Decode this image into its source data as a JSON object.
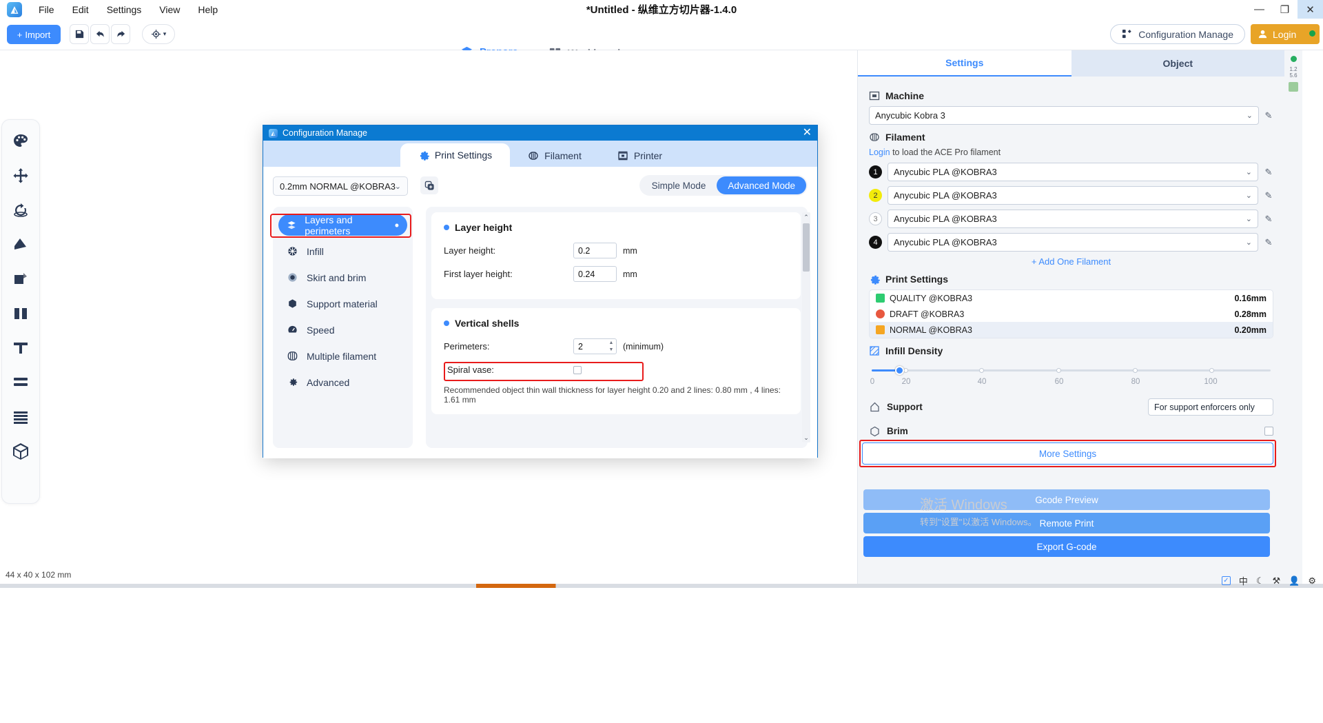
{
  "titlebar": {
    "title": "*Untitled - 纵维立方切片器-1.4.0",
    "menus": [
      "File",
      "Edit",
      "Settings",
      "View",
      "Help"
    ],
    "minimize": "—",
    "restore": "❐",
    "close": "✕"
  },
  "toolbar": {
    "import_label": "Import",
    "import_plus": "+",
    "save_icon": "save-icon",
    "undo_icon": "undo-icon",
    "redo_icon": "redo-icon",
    "view_icon": "view-target-icon",
    "view_caret": "▾",
    "tabs": [
      {
        "label": "Prepare",
        "active": true
      },
      {
        "label": "Workbench",
        "active": false
      }
    ],
    "config_manage_label": "Configuration Manage",
    "login_label": "Login"
  },
  "viewport": {
    "status_dims": "44 x 40 x 102 mm",
    "left_tools": [
      "palette-icon",
      "move-icon",
      "rotate-icon",
      "scale-icon",
      "cut-icon",
      "mirror-icon",
      "support-icon",
      "arrange-icon",
      "layer-icon",
      "cube-icon"
    ]
  },
  "right_panel": {
    "tabs": [
      {
        "label": "Settings",
        "active": true
      },
      {
        "label": "Object",
        "active": false
      }
    ],
    "machine": {
      "section_label": "Machine",
      "value": "Anycubic Kobra 3"
    },
    "filament": {
      "section_label": "Filament",
      "login_prefix": "Login",
      "login_text": " to load the ACE Pro filament",
      "slots": [
        {
          "num": "1",
          "value": "Anycubic PLA @KOBRA3",
          "color": "#111111",
          "text_color": "#ffffff"
        },
        {
          "num": "2",
          "value": "Anycubic PLA @KOBRA3",
          "color": "#f2eb0a",
          "text_color": "#333333"
        },
        {
          "num": "3",
          "value": "Anycubic PLA @KOBRA3",
          "color": "#ffffff",
          "text_color": "#777777"
        },
        {
          "num": "4",
          "value": "Anycubic PLA @KOBRA3",
          "color": "#111111",
          "text_color": "#ffffff"
        }
      ],
      "add_label": "+  Add One Filament"
    },
    "print_settings": {
      "section_label": "Print Settings",
      "rows": [
        {
          "name": "QUALITY @KOBRA3",
          "value": "0.16mm",
          "color": "#2ecc71",
          "selected": false
        },
        {
          "name": "DRAFT @KOBRA3",
          "value": "0.28mm",
          "color": "#e8583f",
          "selected": false
        },
        {
          "name": "NORMAL @KOBRA3",
          "value": "0.20mm",
          "color": "#f5a623",
          "selected": true
        }
      ]
    },
    "infill": {
      "section_label": "Infill Density",
      "labels": [
        "0",
        "20",
        "40",
        "60",
        "80",
        "100"
      ],
      "value": 10
    },
    "support": {
      "label": "Support",
      "value": "For support enforcers only"
    },
    "brim": {
      "label": "Brim",
      "checked": false
    },
    "more_settings_label": "More Settings",
    "buttons": {
      "gcode_preview": "Gcode Preview",
      "remote_print": "Remote Print",
      "export_gcode": "Export G-code"
    },
    "watermark": {
      "line1": "激活 Windows",
      "line2": "转到\"设置\"以激活 Windows。"
    },
    "scale_strip": {
      "top": "1.2",
      "bottom": "5.6"
    }
  },
  "dialog": {
    "title": "Configuration Manage",
    "close": "✕",
    "tabs": [
      {
        "label": "Print Settings",
        "icon": "gear-icon",
        "active": true
      },
      {
        "label": "Filament",
        "icon": "filament-icon",
        "active": false
      },
      {
        "label": "Printer",
        "icon": "printer-icon",
        "active": false
      }
    ],
    "preset": {
      "value": "0.2mm NORMAL @KOBRA3",
      "chevron": "⌄"
    },
    "copy_icon": "duplicate-icon",
    "modes": [
      {
        "label": "Simple Mode",
        "active": false
      },
      {
        "label": "Advanced Mode",
        "active": true
      }
    ],
    "nav": [
      {
        "label": "Layers and perimeters",
        "icon": "layers-icon",
        "active": true,
        "modified": true
      },
      {
        "label": "Infill",
        "icon": "infill-icon",
        "active": false
      },
      {
        "label": "Skirt and brim",
        "icon": "skirt-icon",
        "active": false
      },
      {
        "label": "Support material",
        "icon": "support-icon",
        "active": false
      },
      {
        "label": "Speed",
        "icon": "speed-icon",
        "active": false
      },
      {
        "label": "Multiple filament",
        "icon": "multi-filament-icon",
        "active": false
      },
      {
        "label": "Advanced",
        "icon": "advanced-icon",
        "active": false
      }
    ],
    "layer_height_card": {
      "title": "Layer height",
      "fields": [
        {
          "label": "Layer height:",
          "value": "0.2",
          "unit": "mm"
        },
        {
          "label": "First layer height:",
          "value": "0.24",
          "unit": "mm"
        }
      ]
    },
    "vertical_shells_card": {
      "title": "Vertical shells",
      "perimeters_label": "Perimeters:",
      "perimeters_value": "2",
      "perimeters_unit": "(minimum)",
      "spiral_vase_label": "Spiral vase:",
      "spiral_vase_checked": false,
      "hint": "Recommended object thin wall thickness for layer height 0.20 and 2 lines: 0.80 mm , 4 lines: 1.61 mm"
    },
    "scroll_up": "⌃",
    "scroll_down": "⌄"
  },
  "tray": {
    "check": "✓",
    "ime": "中",
    "moon": "☾",
    "tools": "⚒",
    "user": "👤",
    "gear": "⚙"
  }
}
